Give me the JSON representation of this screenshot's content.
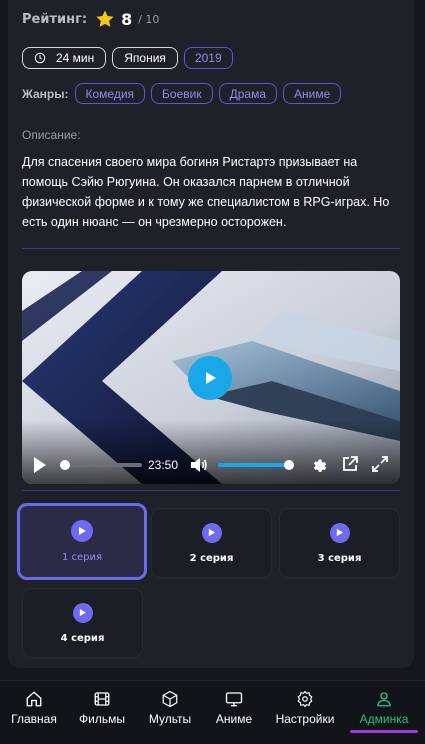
{
  "rating": {
    "label": "Рейтинг:",
    "value": "8",
    "max": "/ 10"
  },
  "meta": {
    "duration": "24 мин",
    "country": "Япония",
    "year": "2019"
  },
  "genres": {
    "label": "Жанры:",
    "items": [
      "Комедия",
      "Боевик",
      "Драма",
      "Аниме"
    ]
  },
  "description": {
    "label": "Описание:",
    "text": "Для спасения своего мира богиня Ристартэ призывает на помощь Сэйю Рюгуина. Он оказался парнем в отличной физической форме и к тому же специалистом в RPG-играх. Но есть один нюанс — он чрезмерно осторожен."
  },
  "player": {
    "time": "23:50",
    "progress": 0.0,
    "volume": 0.9
  },
  "episodes": [
    {
      "label": "1 серия",
      "active": true
    },
    {
      "label": "2 серия",
      "active": false
    },
    {
      "label": "3 серия",
      "active": false
    },
    {
      "label": "4 серия",
      "active": false
    }
  ],
  "nav": {
    "items": [
      {
        "label": "Главная",
        "icon": "home-icon"
      },
      {
        "label": "Фильмы",
        "icon": "film-icon"
      },
      {
        "label": "Мульты",
        "icon": "cube-icon"
      },
      {
        "label": "Аниме",
        "icon": "monitor-icon"
      },
      {
        "label": "Настройки",
        "icon": "gear-icon"
      },
      {
        "label": "Админка",
        "icon": "user-icon"
      }
    ],
    "active_index": 5
  },
  "colors": {
    "accent": "#6d6af0",
    "accent_text": "#8e8cf2",
    "player_blue": "#1aa7e8",
    "active_nav": "#2ec27e"
  }
}
